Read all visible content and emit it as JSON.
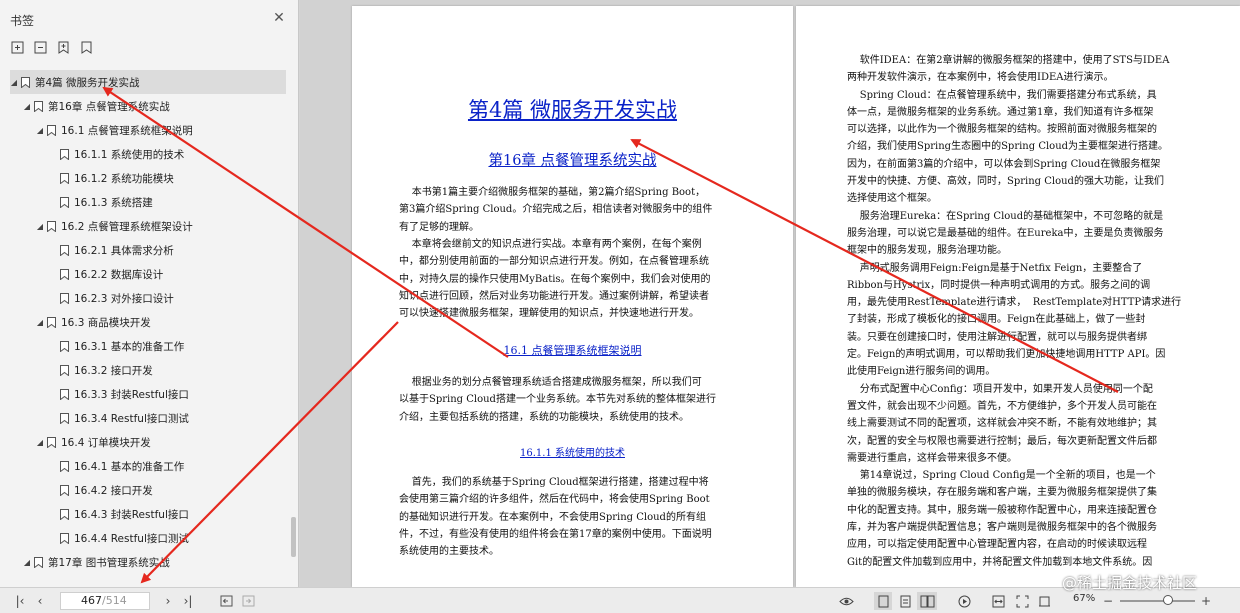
{
  "sidebar": {
    "title": "书签",
    "tools": [
      {
        "name": "expand-all-icon"
      },
      {
        "name": "collapse-all-icon"
      },
      {
        "name": "add-bookmark-icon"
      },
      {
        "name": "bookmark-ribbon-icon"
      }
    ],
    "items": [
      {
        "label": "第4篇  微服务开发实战",
        "caret": "expanded"
      },
      {
        "label": "第16章  点餐管理系统实战",
        "caret": "expanded"
      },
      {
        "label": "16.1  点餐管理系统框架说明",
        "caret": "expanded"
      },
      {
        "label": "16.1.1  系统使用的技术",
        "caret": "none"
      },
      {
        "label": "16.1.2  系统功能模块",
        "caret": "none"
      },
      {
        "label": "16.1.3  系统搭建",
        "caret": "none"
      },
      {
        "label": "16.2  点餐管理系统框架设计",
        "caret": "expanded"
      },
      {
        "label": "16.2.1  具体需求分析",
        "caret": "none"
      },
      {
        "label": "16.2.2  数据库设计",
        "caret": "none"
      },
      {
        "label": "16.2.3  对外接口设计",
        "caret": "none"
      },
      {
        "label": "16.3  商品模块开发",
        "caret": "expanded"
      },
      {
        "label": "16.3.1  基本的准备工作",
        "caret": "none"
      },
      {
        "label": "16.3.2  接口开发",
        "caret": "none"
      },
      {
        "label": "16.3.3  封装Restful接口",
        "caret": "none"
      },
      {
        "label": "16.3.4  Restful接口测试",
        "caret": "none"
      },
      {
        "label": "16.4  订单模块开发",
        "caret": "expanded"
      },
      {
        "label": "16.4.1  基本的准备工作",
        "caret": "none"
      },
      {
        "label": "16.4.2  接口开发",
        "caret": "none"
      },
      {
        "label": "16.4.3  封装Restful接口",
        "caret": "none"
      },
      {
        "label": "16.4.4  Restful接口测试",
        "caret": "none"
      },
      {
        "label": "第17章  图书管理系统实战",
        "caret": "expanded"
      }
    ]
  },
  "left_page": {
    "part_title": "第4篇  微服务开发实战",
    "chapter_title": "第16章  点餐管理系统实战",
    "intro_p1": [
      "    本书第1篇主要介绍微服务框架的基础，第2篇介绍Spring Boot，",
      "第3篇介绍Spring Cloud。介绍完成之后，相信读者对微服务中的组件",
      "有了足够的理解。"
    ],
    "intro_p2": [
      "    本章将会继前文的知识点进行实战。本章有两个案例，在每个案例",
      "中，都分别使用前面的一部分知识点进行开发。例如，在点餐管理系统",
      "中，对持久层的操作只使用MyBatis。在每个案例中，我们会对使用的",
      "知识点进行回顾，然后对业务功能进行开发。通过案例讲解，希望读者",
      "可以快速搭建微服务框架，理解使用的知识点，并快速地进行开发。"
    ],
    "section_title": "16.1  点餐管理系统框架说明",
    "section_p": [
      "    根据业务的划分点餐管理系统适合搭建成微服务框架，所以我们可",
      "以基于Spring Cloud搭建一个业务系统。本节先对系统的整体框架进行",
      "介绍，主要包括系统的搭建，系统的功能模块，系统使用的技术。"
    ],
    "subsection_title": "16.1.1  系统使用的技术",
    "subsection_p": [
      "    首先，我们的系统基于Spring Cloud框架进行搭建，搭建过程中将",
      "会使用第三篇介绍的许多组件，然后在代码中，将会使用Spring Boot",
      "的基础知识进行开发。在本案例中，不会使用Spring Cloud的所有组",
      "件，不过，有些没有使用的组件将会在第17章的案例中使用。下面说明",
      "系统使用的主要技术。"
    ]
  },
  "right_page": {
    "lines": [
      "    软件IDEA：在第2章讲解的微服务框架的搭建中，使用了STS与IDEA",
      "两种开发软件演示，在本案例中，将会使用IDEA进行演示。",
      "    Spring Cloud：在点餐管理系统中，我们需要搭建分布式系统，具",
      "体一点，是微服务框架的业务系统。通过第1章，我们知道有许多框架",
      "可以选择，以此作为一个微服务框架的结构。按照前面对微服务框架的",
      "介绍，我们使用Spring生态圈中的Spring Cloud为主要框架进行搭建。",
      "因为，在前面第3篇的介绍中，可以体会到Spring Cloud在微服务框架",
      "开发中的快捷、方便、高效，同时，Spring Cloud的强大功能，让我们",
      "选择使用这个框架。",
      "    服务治理Eureka：在Spring Cloud的基础框架中，不可忽略的就是",
      "服务治理，可以说它是最基础的组件。在Eureka中，主要是负责微服务",
      "框架中的服务发现，服务治理功能。",
      "    声明式服务调用Feign:Feign是基于Netfix Feign，主要整合了",
      "Ribbon与Hystrix，同时提供一种声明式调用的方式。服务之间的调",
      "用，最先使用RestTemplate进行请求，  RestTemplate对HTTP请求进行",
      "了封装，形成了模板化的接口调用。Feign在此基础上，做了一些封",
      "装。只要在创建接口时，使用注解进行配置，就可以与服务提供者绑",
      "定。Feign的声明式调用，可以帮助我们更加快捷地调用HTTP API。因",
      "此使用Feign进行服务间的调用。",
      "    分布式配置中心Config：项目开发中，如果开发人员使用同一个配",
      "置文件，就会出现不少问题。首先，不方便维护，多个开发人员可能在",
      "线上需要测试不同的配置项，这样就会冲突不断，不能有效地维护；其",
      "次，配置的安全与权限也需要进行控制；最后，每次更新配置文件后都",
      "需要进行重启，这样会带来很多不便。",
      "    第14章说过，Spring Cloud Config是一个全新的项目，也是一个",
      "单独的微服务模块，存在服务端和客户端，主要为微服务框架提供了集",
      "中化的配置支持。其中，服务端一般被称作配置中心，用来连接配置仓",
      "库，并为客户端提供配置信息；客户端则是微服务框架中的各个微服务",
      "应用，可以指定使用配置中心管理配置内容，在启动的时候读取远程",
      "Git的配置文件加载到应用中，并将配置文件加载到本地文件系统。因"
    ]
  },
  "bottom_bar": {
    "current_page": "467",
    "total_pages": "/514",
    "zoom": "67%",
    "zoom_level_fraction": 0.6
  },
  "watermark": "@稀土掘金技术社区",
  "colors": {
    "link_blue": "#0a22c8",
    "arrow_red": "#e5281e"
  }
}
